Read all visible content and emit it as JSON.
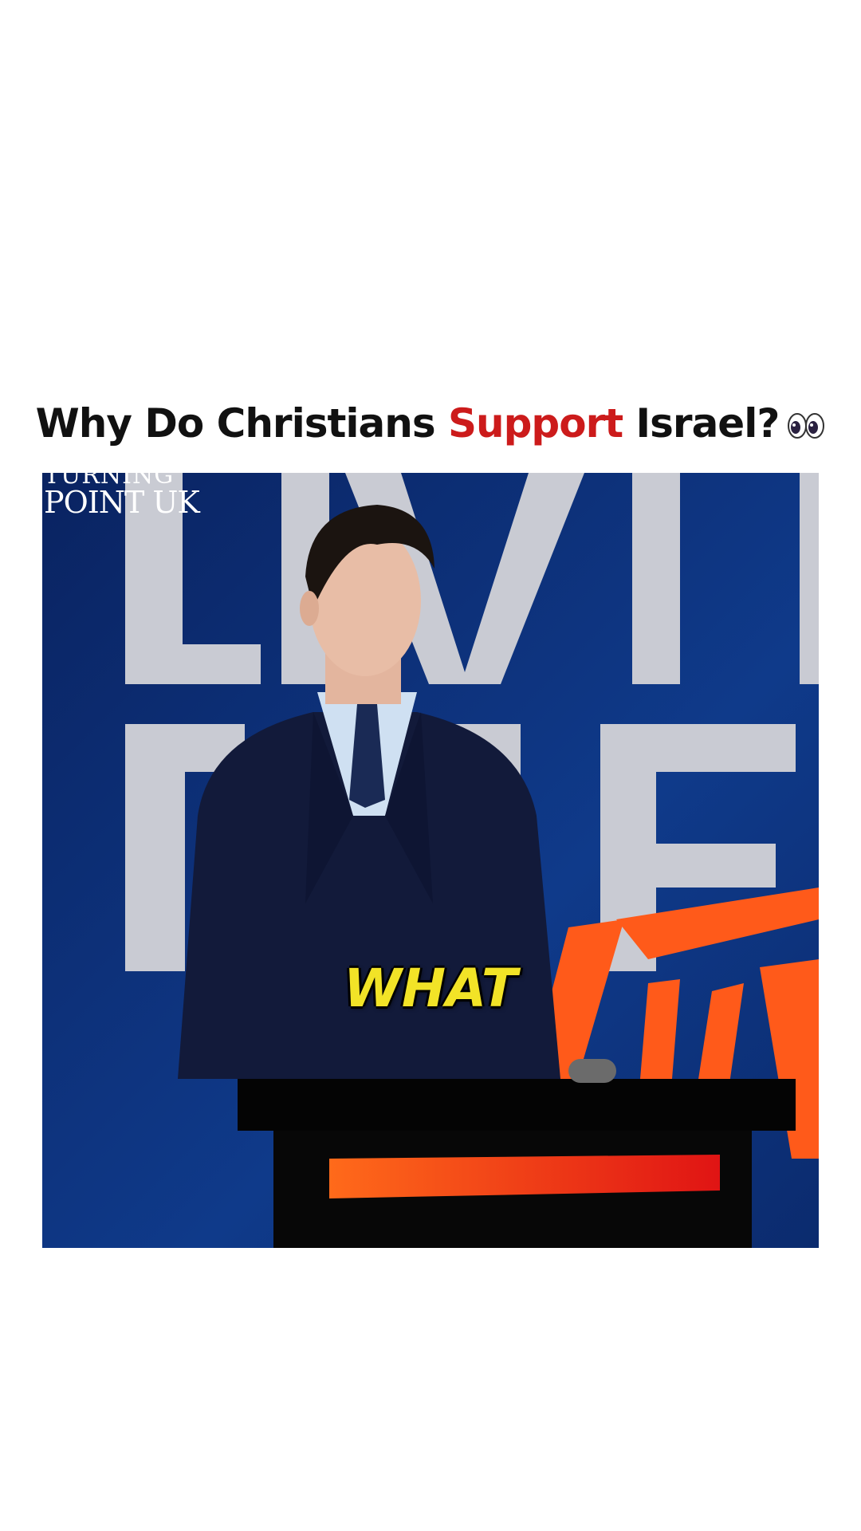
{
  "headline": {
    "part1": "Why Do Christians ",
    "accent": "Support",
    "part2": " Israel?",
    "accent_color": "#cc1b1b",
    "emoji_icon": "eyes-icon"
  },
  "video": {
    "logo_line1": "TURNING",
    "logo_line2": "POINT UK",
    "caption": "WHAT",
    "caption_color": "#f2e327"
  }
}
